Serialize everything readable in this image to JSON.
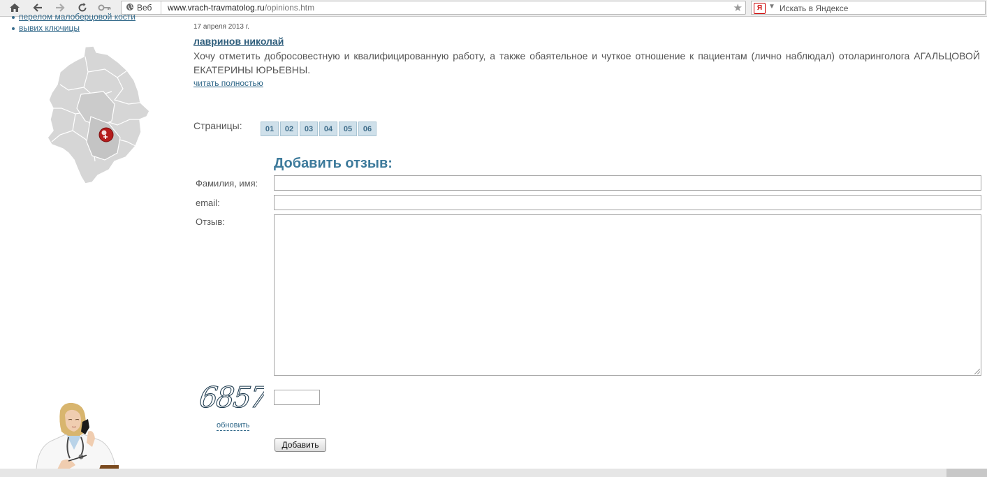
{
  "browser": {
    "search_prefix": "Веб",
    "url_host": "www.vrach-travmatolog.ru",
    "url_path": "/opinions.htm",
    "yandex_badge": "Я",
    "search_placeholder": "Искать в Яндексе"
  },
  "sidebar": {
    "items": [
      {
        "label": "перелом малоберцовой кости"
      },
      {
        "label": "вывих ключицы"
      }
    ]
  },
  "review": {
    "date": "17 апреля 2013 г.",
    "author": "лавринов николай",
    "text": "Хочу отметить добросовестную и квалифицированную работу, а также обаятельное и чуткое отношение к пациентам (лично наблюдал) отоларинголога АГАЛЬЦОВОЙ ЕКАТЕРИНЫ ЮРЬЕВНЫ.",
    "read_more": "читать полностью"
  },
  "pagination": {
    "label": "Страницы:",
    "pages": [
      "01",
      "02",
      "03",
      "04",
      "05",
      "06"
    ]
  },
  "form": {
    "title": "Добавить отзыв:",
    "name_label": "Фамилия, имя:",
    "email_label": "email:",
    "review_label": "Отзыв:",
    "captcha_code": "6857",
    "refresh_label": "обновить",
    "submit_label": "Добавить"
  }
}
